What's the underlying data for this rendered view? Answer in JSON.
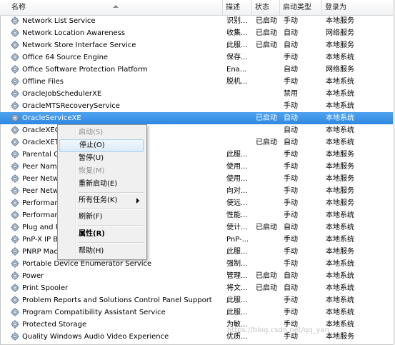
{
  "header": {
    "col_name": "名称",
    "col_desc": "描述",
    "col_status": "状态",
    "col_start": "启动类型",
    "col_logon": "登录为"
  },
  "rows": [
    {
      "name": "Network List Service",
      "desc": "识别...",
      "status": "已启动",
      "start": "手动",
      "logon": "本地服务"
    },
    {
      "name": "Network Location Awareness",
      "desc": "收集...",
      "status": "已启动",
      "start": "自动",
      "logon": "网络服务"
    },
    {
      "name": "Network Store Interface Service",
      "desc": "此服...",
      "status": "已启动",
      "start": "自动",
      "logon": "本地服务"
    },
    {
      "name": "Office 64 Source Engine",
      "desc": "保存...",
      "status": "",
      "start": "手动",
      "logon": "本地系统"
    },
    {
      "name": "Office Software Protection Platform",
      "desc": "Ena...",
      "status": "",
      "start": "自动",
      "logon": "网络服务"
    },
    {
      "name": "Offline Files",
      "desc": "脱机...",
      "status": "",
      "start": "手动",
      "logon": "本地系统"
    },
    {
      "name": "OracleJobSchedulerXE",
      "desc": "",
      "status": "",
      "start": "禁用",
      "logon": "本地系统"
    },
    {
      "name": "OracleMTSRecoveryService",
      "desc": "",
      "status": "",
      "start": "手动",
      "logon": "本地系统"
    },
    {
      "name": "OracleServiceXE",
      "desc": "",
      "status": "已启动",
      "start": "自动",
      "logon": "本地系统"
    },
    {
      "name": "OracleXECl",
      "desc": "",
      "status": "",
      "start": "自动",
      "logon": "本地系统"
    },
    {
      "name": "OracleXETN",
      "desc": "",
      "status": "已启动",
      "start": "自动",
      "logon": "本地系统"
    },
    {
      "name": "Parental Co",
      "desc": "此服...",
      "status": "",
      "start": "手动",
      "logon": "本地服务"
    },
    {
      "name": "Peer Name",
      "desc": "使用...",
      "status": "",
      "start": "手动",
      "logon": "本地服务"
    },
    {
      "name": "Peer Netwo",
      "desc": "使用...",
      "status": "",
      "start": "手动",
      "logon": "本地服务"
    },
    {
      "name": "Peer Netwo",
      "desc": "向对...",
      "status": "",
      "start": "手动",
      "logon": "本地服务"
    },
    {
      "name": "Performanc",
      "desc": "使远...",
      "status": "",
      "start": "手动",
      "logon": "本地服务"
    },
    {
      "name": "Performanc",
      "desc": "性能...",
      "status": "",
      "start": "手动",
      "logon": "本地系统"
    },
    {
      "name": "Plug and Pl",
      "desc": "使计...",
      "status": "已启动",
      "start": "自动",
      "logon": "本地系统"
    },
    {
      "name": "PnP-X IP Bu",
      "desc": "PnP-...",
      "status": "",
      "start": "手动",
      "logon": "本地系统"
    },
    {
      "name": "PNRP Mach                              ice",
      "desc": "此服...",
      "status": "",
      "start": "手动",
      "logon": "本地服务"
    },
    {
      "name": "Portable Device Enumerator Service",
      "desc": "强制...",
      "status": "",
      "start": "手动",
      "logon": "本地系统"
    },
    {
      "name": "Power",
      "desc": "管理...",
      "status": "已启动",
      "start": "自动",
      "logon": "本地系统"
    },
    {
      "name": "Print Spooler",
      "desc": "将文...",
      "status": "已启动",
      "start": "自动",
      "logon": "本地系统"
    },
    {
      "name": "Problem Reports and Solutions Control Panel Support",
      "desc": "此服...",
      "status": "",
      "start": "手动",
      "logon": "本地系统"
    },
    {
      "name": "Program Compatibility Assistant Service",
      "desc": "此服...",
      "status": "",
      "start": "手动",
      "logon": "本地系统"
    },
    {
      "name": "Protected Storage",
      "desc": "为敏...",
      "status": "",
      "start": "手动",
      "logon": "本地系统"
    },
    {
      "name": "Quality Windows Audio Video Experience",
      "desc": "优质...",
      "status": "",
      "start": "手动",
      "logon": "本地服务"
    }
  ],
  "selected_row": 8,
  "context_menu": {
    "start": "启动(S)",
    "stop": "停止(O)",
    "pause": "暂停(U)",
    "resume": "恢复(M)",
    "restart": "重新启动(E)",
    "all_tasks": "所有任务(K)",
    "refresh": "刷新(F)",
    "properties": "属性(R)",
    "help": "帮助(H)"
  },
  "watermark": "https://blog.csdn.net/qq_yan",
  "colors": {
    "selection": "#3391e6",
    "menu_bg": "#f0f0f0",
    "menu_hover": "#dceaf8"
  },
  "icons": {
    "service": "gear-icon",
    "submenu": "chevron-right-icon"
  }
}
